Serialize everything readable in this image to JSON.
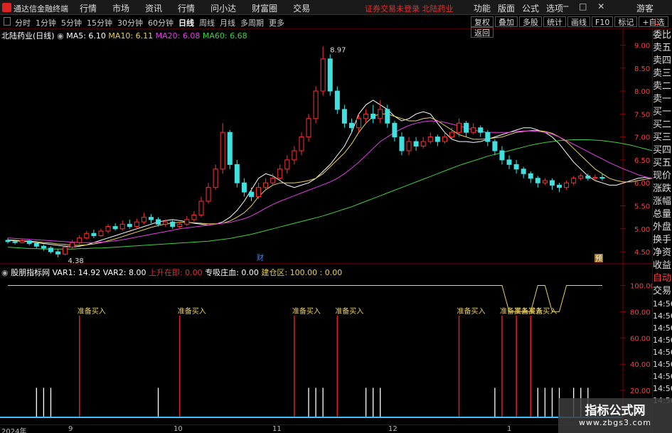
{
  "app": {
    "title": "通达信金融终端",
    "menu": [
      "行情",
      "市场",
      "资讯",
      "行情",
      "问小达",
      "财富圈",
      "交易"
    ],
    "message": "证券交易未登录  北陆药业",
    "right_menu": [
      "功能",
      "版面",
      "公式",
      "选项"
    ],
    "guest": "游客"
  },
  "periodbar": {
    "periods": [
      "分时",
      "1分钟",
      "5分钟",
      "15分钟",
      "30分钟",
      "60分钟",
      "日线",
      "周线",
      "月线",
      "多周期",
      "更多"
    ],
    "active": "日线",
    "tools": [
      "复权",
      "叠加",
      "多股",
      "统计",
      "画线",
      "F10",
      "标记",
      "+自选",
      "返回"
    ]
  },
  "main": {
    "stock_name": "北陆药业(日线)",
    "ma": [
      {
        "label": "MA5: 6.10",
        "color": "#ffffff"
      },
      {
        "label": "MA10: 6.11",
        "color": "#e8d060"
      },
      {
        "label": "MA20: 6.08",
        "color": "#e040e0"
      },
      {
        "label": "MA60: 6.68",
        "color": "#40d040"
      }
    ],
    "high_label": "8.97",
    "low_label": "4.38",
    "event_labels": [
      "财",
      "预"
    ],
    "price_ticks": [
      "9.00",
      "8.50",
      "8.00",
      "7.50",
      "7.00",
      "6.50",
      "6.00",
      "5.50",
      "5.00",
      "4.50"
    ],
    "ylim": [
      4.3,
      9.1
    ]
  },
  "indicator": {
    "name": "股朋指标网",
    "var1": "VAR1: 14.92",
    "var2": "VAR2: 8.00",
    "rising": "上升在即: 0.00",
    "zhuang": "专吸庄血: 0.00",
    "build": "建仓区: 100.00 : 0.00",
    "signal_label": "准备买入",
    "ticks": [
      "100.00",
      "80.00",
      "60.00",
      "40.00",
      "20.00"
    ],
    "ylim": [
      0,
      110
    ]
  },
  "right_panel": {
    "top": "L",
    "items": [
      "委比",
      "卖五",
      "卖四",
      "卖三",
      "卖二",
      "卖一",
      "买一",
      "买二",
      "买三",
      "买四",
      "买五",
      "现价",
      "涨跌",
      "涨幅",
      "总量",
      "外盘",
      "换手",
      "净资",
      "收益",
      "自动",
      "交易",
      "14:56",
      "14:56",
      "14:56",
      "14:56",
      "14:56",
      "14:56",
      "14:56",
      "14:56",
      "14:56"
    ]
  },
  "dates": [
    "2024年",
    "9",
    "10",
    "11",
    "12",
    "1"
  ],
  "watermark": {
    "line1": "指标公式网",
    "line2": "www.zbgs3.com"
  },
  "chart_data": {
    "type": "candlestick",
    "title": "北陆药业(日线)",
    "series": [
      {
        "name": "MA5",
        "values": [
          4.75,
          4.74,
          4.73,
          4.72,
          4.7,
          4.68,
          4.66,
          4.64,
          4.62,
          4.6,
          4.62,
          4.65,
          4.7,
          4.75,
          4.8,
          4.85,
          4.9,
          4.95,
          5.0,
          5.05,
          5.1,
          5.15,
          5.18,
          5.2,
          5.18,
          5.15,
          5.12,
          5.1,
          5.08,
          5.1,
          5.15,
          5.25,
          5.4,
          5.6,
          5.85,
          6.1,
          6.2,
          6.15,
          6.05,
          5.95,
          5.9,
          5.95,
          6.0,
          6.1,
          6.25,
          6.4,
          6.6,
          6.8,
          7.1,
          7.5,
          7.7,
          7.8,
          7.7,
          7.6,
          7.45,
          7.35,
          7.4,
          7.5,
          7.55,
          7.5,
          7.3,
          7.1,
          6.95,
          6.9,
          6.9,
          6.88,
          6.9,
          6.95,
          7.0,
          7.05,
          7.1,
          7.15,
          7.2,
          7.2,
          7.15,
          7.1,
          7.0,
          6.85,
          6.65,
          6.45,
          6.3,
          6.15,
          6.05,
          6.0,
          5.95,
          5.95,
          6.0,
          6.05,
          6.1,
          6.12,
          6.1,
          6.1
        ]
      },
      {
        "name": "MA10",
        "values": [
          4.76,
          4.75,
          4.74,
          4.73,
          4.72,
          4.7,
          4.69,
          4.67,
          4.66,
          4.64,
          4.64,
          4.65,
          4.67,
          4.7,
          4.74,
          4.78,
          4.83,
          4.88,
          4.93,
          4.98,
          5.03,
          5.07,
          5.1,
          5.13,
          5.14,
          5.14,
          5.13,
          5.12,
          5.11,
          5.11,
          5.12,
          5.17,
          5.25,
          5.35,
          5.5,
          5.7,
          5.85,
          5.95,
          6.0,
          6.0,
          6.0,
          6.02,
          6.05,
          6.1,
          6.2,
          6.35,
          6.5,
          6.65,
          6.85,
          7.1,
          7.3,
          7.45,
          7.5,
          7.5,
          7.45,
          7.4,
          7.35,
          7.35,
          7.4,
          7.42,
          7.35,
          7.25,
          7.15,
          7.05,
          7.0,
          6.95,
          6.95,
          6.96,
          6.98,
          7.0,
          7.05,
          7.1,
          7.12,
          7.14,
          7.14,
          7.12,
          7.08,
          7.0,
          6.9,
          6.75,
          6.6,
          6.45,
          6.3,
          6.2,
          6.1,
          6.05,
          6.02,
          6.02,
          6.05,
          6.08,
          6.1,
          6.11
        ]
      },
      {
        "name": "MA20",
        "values": [
          4.8,
          4.79,
          4.78,
          4.77,
          4.76,
          4.75,
          4.74,
          4.73,
          4.72,
          4.71,
          4.7,
          4.7,
          4.7,
          4.71,
          4.72,
          4.74,
          4.76,
          4.79,
          4.82,
          4.85,
          4.88,
          4.91,
          4.94,
          4.97,
          5.0,
          5.02,
          5.04,
          5.06,
          5.08,
          5.1,
          5.12,
          5.14,
          5.18,
          5.22,
          5.28,
          5.36,
          5.45,
          5.53,
          5.6,
          5.66,
          5.72,
          5.78,
          5.84,
          5.9,
          5.96,
          6.02,
          6.1,
          6.2,
          6.32,
          6.45,
          6.6,
          6.75,
          6.9,
          7.0,
          7.1,
          7.18,
          7.25,
          7.3,
          7.33,
          7.35,
          7.34,
          7.32,
          7.28,
          7.24,
          7.2,
          7.15,
          7.12,
          7.1,
          7.1,
          7.1,
          7.1,
          7.12,
          7.13,
          7.13,
          7.12,
          7.1,
          7.06,
          7.0,
          6.92,
          6.84,
          6.76,
          6.68,
          6.6,
          6.52,
          6.44,
          6.37,
          6.3,
          6.24,
          6.18,
          6.13,
          6.1,
          6.08
        ]
      },
      {
        "name": "MA60",
        "values": [
          4.6,
          4.59,
          4.58,
          4.57,
          4.57,
          4.56,
          4.56,
          4.56,
          4.56,
          4.56,
          4.57,
          4.57,
          4.58,
          4.58,
          4.59,
          4.6,
          4.61,
          4.62,
          4.63,
          4.64,
          4.65,
          4.66,
          4.67,
          4.68,
          4.69,
          4.7,
          4.71,
          4.72,
          4.73,
          4.75,
          4.77,
          4.79,
          4.82,
          4.85,
          4.88,
          4.92,
          4.96,
          5.0,
          5.04,
          5.08,
          5.12,
          5.16,
          5.2,
          5.24,
          5.28,
          5.33,
          5.38,
          5.43,
          5.48,
          5.54,
          5.6,
          5.66,
          5.72,
          5.78,
          5.84,
          5.9,
          5.96,
          6.02,
          6.08,
          6.14,
          6.2,
          6.26,
          6.32,
          6.38,
          6.43,
          6.48,
          6.53,
          6.58,
          6.62,
          6.66,
          6.7,
          6.74,
          6.78,
          6.82,
          6.85,
          6.88,
          6.9,
          6.92,
          6.93,
          6.94,
          6.94,
          6.94,
          6.93,
          6.92,
          6.9,
          6.88,
          6.85,
          6.82,
          6.78,
          6.74,
          6.7,
          6.68
        ]
      }
    ],
    "candles": [
      [
        4.75,
        4.72,
        4.8,
        4.68
      ],
      [
        4.72,
        4.7,
        4.76,
        4.66
      ],
      [
        4.7,
        4.74,
        4.78,
        4.68
      ],
      [
        4.74,
        4.68,
        4.76,
        4.64
      ],
      [
        4.68,
        4.62,
        4.7,
        4.58
      ],
      [
        4.62,
        4.58,
        4.66,
        4.52
      ],
      [
        4.58,
        4.5,
        4.62,
        4.46
      ],
      [
        4.5,
        4.45,
        4.55,
        4.38
      ],
      [
        4.45,
        4.6,
        4.65,
        4.42
      ],
      [
        4.6,
        4.7,
        4.76,
        4.56
      ],
      [
        4.7,
        4.8,
        4.86,
        4.66
      ],
      [
        4.8,
        4.9,
        4.95,
        4.76
      ],
      [
        4.9,
        4.85,
        4.98,
        4.8
      ],
      [
        4.85,
        4.95,
        5.0,
        4.82
      ],
      [
        4.95,
        5.05,
        5.1,
        4.9
      ],
      [
        5.05,
        5.0,
        5.12,
        4.96
      ],
      [
        5.0,
        5.1,
        5.18,
        4.96
      ],
      [
        5.1,
        5.05,
        5.2,
        5.0
      ],
      [
        5.05,
        5.15,
        5.22,
        5.0
      ],
      [
        5.15,
        5.25,
        5.35,
        5.1
      ],
      [
        5.25,
        5.2,
        5.32,
        5.12
      ],
      [
        5.2,
        5.1,
        5.25,
        5.05
      ],
      [
        5.1,
        5.15,
        5.2,
        5.05
      ],
      [
        5.15,
        5.05,
        5.2,
        5.0
      ],
      [
        5.05,
        5.1,
        5.15,
        5.0
      ],
      [
        5.1,
        5.2,
        5.28,
        5.06
      ],
      [
        5.2,
        5.3,
        5.38,
        5.15
      ],
      [
        5.3,
        5.6,
        5.7,
        5.25
      ],
      [
        5.6,
        5.9,
        6.0,
        5.55
      ],
      [
        5.9,
        6.3,
        6.4,
        5.85
      ],
      [
        6.3,
        7.1,
        7.3,
        6.2
      ],
      [
        7.1,
        6.4,
        7.15,
        6.3
      ],
      [
        6.4,
        6.0,
        6.5,
        5.9
      ],
      [
        6.0,
        5.8,
        6.1,
        5.7
      ],
      [
        5.8,
        5.7,
        5.9,
        5.6
      ],
      [
        5.7,
        5.9,
        6.0,
        5.65
      ],
      [
        5.9,
        6.0,
        6.1,
        5.85
      ],
      [
        6.0,
        6.1,
        6.2,
        5.95
      ],
      [
        6.1,
        6.3,
        6.4,
        6.05
      ],
      [
        6.3,
        6.5,
        6.6,
        6.2
      ],
      [
        6.5,
        6.7,
        6.8,
        6.4
      ],
      [
        6.7,
        7.0,
        7.1,
        6.6
      ],
      [
        7.0,
        7.4,
        7.5,
        6.9
      ],
      [
        7.4,
        8.0,
        8.1,
        7.3
      ],
      [
        8.0,
        8.7,
        8.97,
        7.9
      ],
      [
        8.7,
        8.0,
        8.8,
        7.9
      ],
      [
        8.0,
        7.6,
        8.1,
        7.5
      ],
      [
        7.6,
        7.3,
        7.7,
        7.2
      ],
      [
        7.3,
        7.2,
        7.4,
        7.1
      ],
      [
        7.2,
        7.4,
        7.5,
        7.1
      ],
      [
        7.4,
        7.5,
        7.6,
        7.3
      ],
      [
        7.5,
        7.4,
        7.7,
        7.3
      ],
      [
        7.4,
        7.6,
        7.8,
        7.3
      ],
      [
        7.6,
        7.3,
        7.7,
        7.2
      ],
      [
        7.3,
        7.0,
        7.35,
        6.9
      ],
      [
        7.0,
        6.7,
        7.1,
        6.6
      ],
      [
        6.7,
        6.9,
        7.0,
        6.6
      ],
      [
        6.9,
        6.8,
        7.0,
        6.7
      ],
      [
        6.8,
        6.9,
        7.0,
        6.75
      ],
      [
        6.9,
        7.0,
        7.1,
        6.85
      ],
      [
        7.0,
        6.9,
        7.05,
        6.8
      ],
      [
        6.9,
        7.0,
        7.1,
        6.85
      ],
      [
        7.0,
        7.1,
        7.2,
        6.95
      ],
      [
        7.1,
        7.3,
        7.4,
        7.0
      ],
      [
        7.3,
        7.1,
        7.35,
        7.0
      ],
      [
        7.1,
        7.2,
        7.3,
        7.05
      ],
      [
        7.2,
        7.1,
        7.25,
        7.0
      ],
      [
        7.1,
        6.9,
        7.15,
        6.8
      ],
      [
        6.9,
        6.7,
        6.95,
        6.6
      ],
      [
        6.7,
        6.5,
        6.8,
        6.4
      ],
      [
        6.5,
        6.4,
        6.6,
        6.3
      ],
      [
        6.4,
        6.3,
        6.5,
        6.2
      ],
      [
        6.3,
        6.2,
        6.35,
        6.1
      ],
      [
        6.2,
        6.1,
        6.25,
        6.0
      ],
      [
        6.1,
        6.0,
        6.15,
        5.9
      ],
      [
        6.0,
        6.05,
        6.1,
        5.95
      ],
      [
        6.05,
        5.95,
        6.1,
        5.85
      ],
      [
        5.95,
        5.9,
        6.0,
        5.8
      ],
      [
        5.9,
        6.0,
        6.05,
        5.85
      ],
      [
        6.0,
        6.1,
        6.15,
        5.95
      ],
      [
        6.1,
        6.15,
        6.2,
        6.05
      ],
      [
        6.15,
        6.1,
        6.2,
        6.05
      ],
      [
        6.1,
        6.12,
        6.18,
        6.05
      ],
      [
        6.12,
        6.1,
        6.2,
        6.05
      ]
    ],
    "signal_bars": [
      10,
      24,
      40,
      46,
      63,
      69,
      71,
      73
    ],
    "var_line": [
      100,
      100,
      100,
      100,
      100,
      100,
      100,
      100,
      100,
      100,
      100,
      100,
      100,
      100,
      100,
      100,
      100,
      100,
      100,
      100,
      100,
      100,
      100,
      100,
      100,
      100,
      100,
      100,
      100,
      100,
      100,
      100,
      100,
      100,
      100,
      100,
      100,
      100,
      100,
      100,
      100,
      100,
      100,
      100,
      100,
      100,
      100,
      100,
      100,
      100,
      100,
      100,
      100,
      100,
      100,
      100,
      100,
      100,
      100,
      100,
      100,
      100,
      100,
      100,
      100,
      100,
      100,
      100,
      100,
      100,
      80,
      80,
      80,
      80,
      100,
      100,
      80,
      80,
      100,
      100,
      100,
      100,
      100,
      100,
      100,
      100,
      100,
      100,
      100,
      100,
      100,
      100,
      100,
      100
    ]
  }
}
